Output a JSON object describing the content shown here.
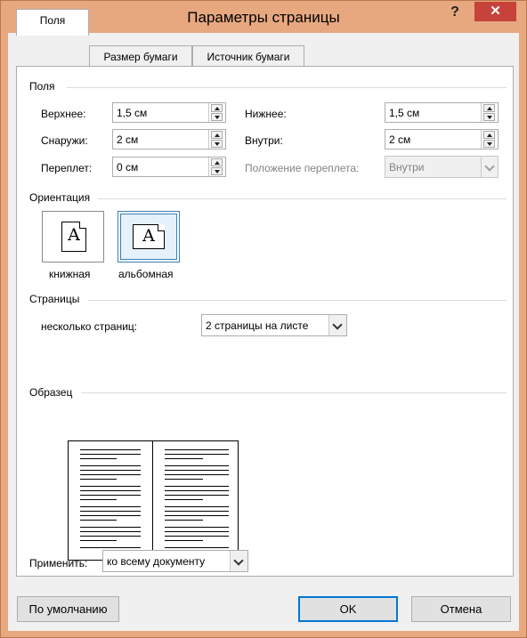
{
  "window": {
    "title": "Параметры страницы",
    "help_label": "?",
    "close_label": "✕"
  },
  "tabs": [
    "Поля",
    "Размер бумаги",
    "Источник бумаги"
  ],
  "margins_section": {
    "title": "Поля",
    "top_label": "Верхнее:",
    "top_value": "1,5 см",
    "bottom_label": "Нижнее:",
    "bottom_value": "1,5 см",
    "outside_label": "Снаружи:",
    "outside_value": "2 см",
    "inside_label": "Внутри:",
    "inside_value": "2 см",
    "gutter_label": "Переплет:",
    "gutter_value": "0 см",
    "gutter_position_label": "Положение переплета:",
    "gutter_position_value": "Внутри"
  },
  "orientation_section": {
    "title": "Ориентация",
    "portrait_label": "книжная",
    "landscape_label": "альбомная",
    "icon_letter": "A",
    "selected": "landscape"
  },
  "pages_section": {
    "title": "Страницы",
    "multiple_pages_label": "несколько страниц:",
    "multiple_pages_value": "2 страницы на листе"
  },
  "preview_section": {
    "title": "Образец"
  },
  "apply": {
    "label": "Применить:",
    "value": "ко всему документу"
  },
  "buttons": {
    "default_label": "По умолчанию",
    "ok_label": "OK",
    "cancel_label": "Отмена"
  },
  "colors": {
    "title_bar": "#e7a880",
    "close_button": "#c7423b",
    "focus": "#0078d7"
  }
}
